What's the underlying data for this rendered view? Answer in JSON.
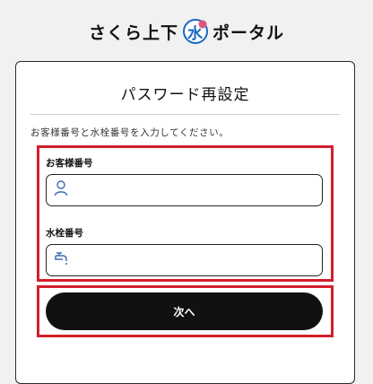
{
  "header": {
    "brand_prefix": "さくら上下",
    "logo_char": "水",
    "brand_suffix": "ポータル"
  },
  "card": {
    "title": "パスワード再設定",
    "instruction": "お客様番号と水栓番号を入力してください。"
  },
  "form": {
    "customer_number": {
      "label": "お客様番号",
      "value": "",
      "icon": "person-icon"
    },
    "tap_number": {
      "label": "水栓番号",
      "value": "",
      "icon": "faucet-icon"
    },
    "next_label": "次へ"
  },
  "colors": {
    "highlight": "#d21f2b",
    "brand_blue": "#1a67c4",
    "logo_pink": "#e0567a",
    "button_bg": "#111111"
  }
}
